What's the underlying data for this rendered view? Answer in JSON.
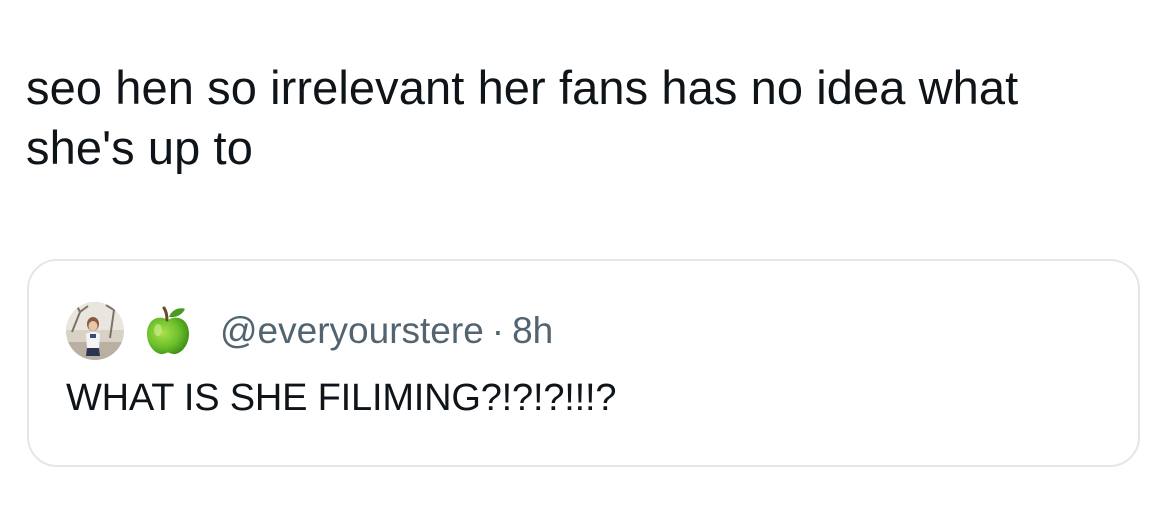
{
  "tweet": {
    "text": "seo hen so irrelevant her fans has no idea what she's up to"
  },
  "quoted_tweet": {
    "handle": "@everyourstere",
    "separator": "·",
    "time": "8h",
    "text": "WHAT IS SHE FILIMING?!?!?!!!?",
    "avatar_icon": "profile-photo-icon",
    "badge_icon": "green-apple-emoji-icon"
  },
  "colors": {
    "text": "#0f1419",
    "secondary_text": "#536471",
    "card_border": "#e3e6ea",
    "background": "#ffffff"
  }
}
